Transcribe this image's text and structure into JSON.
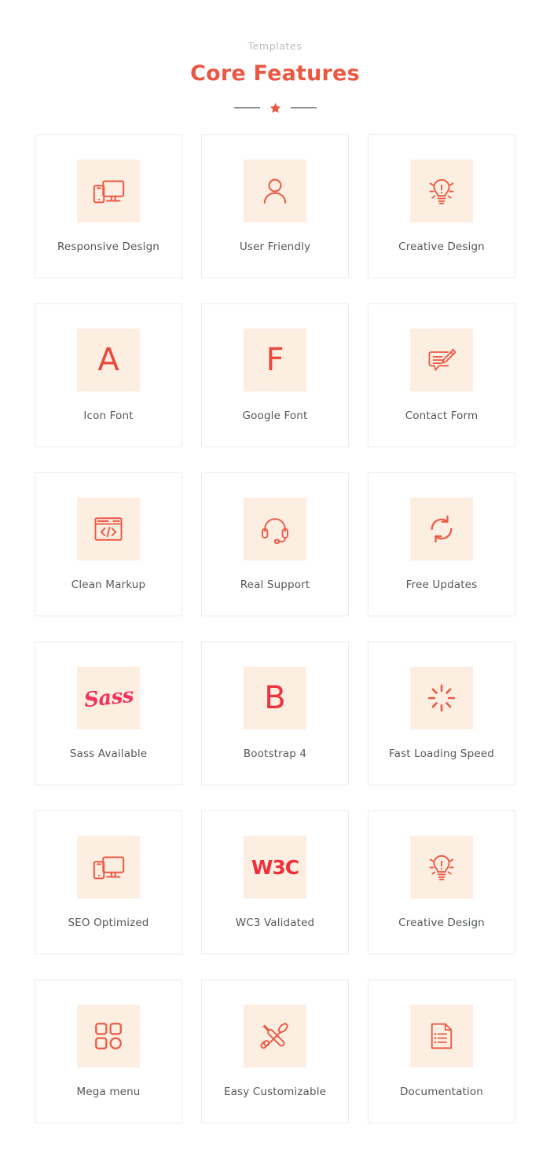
{
  "header": {
    "eyebrow": "Templates",
    "title": "Core Features",
    "divider_icon": "star-icon"
  },
  "colors": {
    "accent": "#ea5843",
    "icon": "#eb5a45",
    "icon_box_bg": "#fdeee2",
    "label_text": "#54585b",
    "eyebrow_text": "#b9bcbe",
    "card_border": "#ececec",
    "page_bg": "#ffffff",
    "divider_dash": "#8d9093",
    "sass_pink": "#f3315a",
    "w3c_red": "#f0313c"
  },
  "features": [
    {
      "label": "Responsive Design",
      "icon": "responsive-devices-icon"
    },
    {
      "label": "User Friendly",
      "icon": "user-icon"
    },
    {
      "label": "Creative Design",
      "icon": "lightbulb-idea-icon"
    },
    {
      "label": "Icon Font",
      "icon": "letter-a-icon",
      "glyph": "A"
    },
    {
      "label": "Google Font",
      "icon": "letter-f-icon",
      "glyph": "F"
    },
    {
      "label": "Contact Form",
      "icon": "chat-pencil-icon"
    },
    {
      "label": "Clean Markup",
      "icon": "code-window-icon"
    },
    {
      "label": "Real Support",
      "icon": "headset-icon"
    },
    {
      "label": "Free Updates",
      "icon": "refresh-sync-icon"
    },
    {
      "label": "Sass Available",
      "icon": "sass-logo-icon",
      "glyph": "Sass"
    },
    {
      "label": "Bootstrap 4",
      "icon": "letter-b-icon",
      "glyph": "B"
    },
    {
      "label": "Fast Loading Speed",
      "icon": "spinner-icon"
    },
    {
      "label": "SEO Optimized",
      "icon": "responsive-devices-icon"
    },
    {
      "label": "WC3 Validated",
      "icon": "w3c-logo-icon",
      "glyph": "W3C"
    },
    {
      "label": "Creative Design",
      "icon": "lightbulb-idea-icon"
    },
    {
      "label": "Mega menu",
      "icon": "grid-blocks-icon"
    },
    {
      "label": "Easy Customizable",
      "icon": "wrench-screwdriver-icon"
    },
    {
      "label": "Documentation",
      "icon": "document-list-icon"
    }
  ]
}
